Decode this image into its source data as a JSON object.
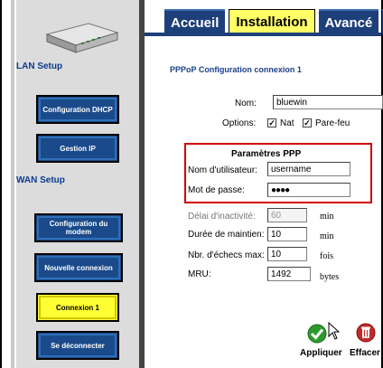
{
  "tabs": [
    {
      "label": "Accueil",
      "active": false
    },
    {
      "label": "Installation",
      "active": true
    },
    {
      "label": "Avancé",
      "active": false
    }
  ],
  "sidebar": {
    "lan_setup": "LAN Setup",
    "wan_setup": "WAN Setup",
    "buttons": [
      {
        "label": "Configuration DHCP"
      },
      {
        "label": "Gestion IP"
      },
      {
        "label": "Configuration du modem"
      },
      {
        "label": "Nouvelle connexion"
      },
      {
        "label": "Connexion 1",
        "active": true
      },
      {
        "label": "Se déconnecter"
      }
    ]
  },
  "main": {
    "heading": "PPPoP Configuration connexion 1",
    "name_label": "Nom:",
    "name_value": "bluewin",
    "options_label": "Options:",
    "nat_label": "Nat",
    "nat_checked": true,
    "firewall_label": "Pare-feu",
    "firewall_checked": true,
    "ppp_title": "Paramètres PPP",
    "user_label": "Nom d'utilisateur:",
    "user_value": "username",
    "pass_label": "Mot de passe:",
    "pass_value": "●●●●",
    "idle_label": "Délai d'inactivité:",
    "idle_value": "60",
    "idle_unit": "min",
    "keepalive_label": "Durée de maintien:",
    "keepalive_value": "10",
    "keepalive_unit": "min",
    "failures_label": "Nbr. d'échecs max:",
    "failures_value": "10",
    "failures_unit": "fois",
    "mru_label": "MRU:",
    "mru_value": "1492",
    "mru_unit": "bytes"
  },
  "actions": {
    "apply_label": "Appliquer",
    "delete_label": "Effacer"
  },
  "colors": {
    "tab_blue": "#1d3f7a",
    "active_yellow": "#ffff33",
    "highlight_red": "#d00000",
    "apply_green": "#2e9a2e",
    "delete_red": "#c62828"
  }
}
